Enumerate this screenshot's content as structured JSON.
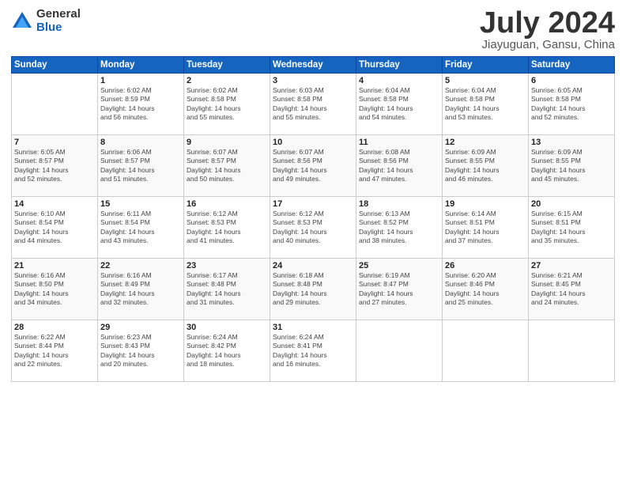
{
  "logo": {
    "general": "General",
    "blue": "Blue"
  },
  "title": "July 2024",
  "subtitle": "Jiayuguan, Gansu, China",
  "days_header": [
    "Sunday",
    "Monday",
    "Tuesday",
    "Wednesday",
    "Thursday",
    "Friday",
    "Saturday"
  ],
  "weeks": [
    [
      {
        "num": "",
        "info": ""
      },
      {
        "num": "1",
        "info": "Sunrise: 6:02 AM\nSunset: 8:59 PM\nDaylight: 14 hours\nand 56 minutes."
      },
      {
        "num": "2",
        "info": "Sunrise: 6:02 AM\nSunset: 8:58 PM\nDaylight: 14 hours\nand 55 minutes."
      },
      {
        "num": "3",
        "info": "Sunrise: 6:03 AM\nSunset: 8:58 PM\nDaylight: 14 hours\nand 55 minutes."
      },
      {
        "num": "4",
        "info": "Sunrise: 6:04 AM\nSunset: 8:58 PM\nDaylight: 14 hours\nand 54 minutes."
      },
      {
        "num": "5",
        "info": "Sunrise: 6:04 AM\nSunset: 8:58 PM\nDaylight: 14 hours\nand 53 minutes."
      },
      {
        "num": "6",
        "info": "Sunrise: 6:05 AM\nSunset: 8:58 PM\nDaylight: 14 hours\nand 52 minutes."
      }
    ],
    [
      {
        "num": "7",
        "info": "Sunrise: 6:05 AM\nSunset: 8:57 PM\nDaylight: 14 hours\nand 52 minutes."
      },
      {
        "num": "8",
        "info": "Sunrise: 6:06 AM\nSunset: 8:57 PM\nDaylight: 14 hours\nand 51 minutes."
      },
      {
        "num": "9",
        "info": "Sunrise: 6:07 AM\nSunset: 8:57 PM\nDaylight: 14 hours\nand 50 minutes."
      },
      {
        "num": "10",
        "info": "Sunrise: 6:07 AM\nSunset: 8:56 PM\nDaylight: 14 hours\nand 49 minutes."
      },
      {
        "num": "11",
        "info": "Sunrise: 6:08 AM\nSunset: 8:56 PM\nDaylight: 14 hours\nand 47 minutes."
      },
      {
        "num": "12",
        "info": "Sunrise: 6:09 AM\nSunset: 8:55 PM\nDaylight: 14 hours\nand 46 minutes."
      },
      {
        "num": "13",
        "info": "Sunrise: 6:09 AM\nSunset: 8:55 PM\nDaylight: 14 hours\nand 45 minutes."
      }
    ],
    [
      {
        "num": "14",
        "info": "Sunrise: 6:10 AM\nSunset: 8:54 PM\nDaylight: 14 hours\nand 44 minutes."
      },
      {
        "num": "15",
        "info": "Sunrise: 6:11 AM\nSunset: 8:54 PM\nDaylight: 14 hours\nand 43 minutes."
      },
      {
        "num": "16",
        "info": "Sunrise: 6:12 AM\nSunset: 8:53 PM\nDaylight: 14 hours\nand 41 minutes."
      },
      {
        "num": "17",
        "info": "Sunrise: 6:12 AM\nSunset: 8:53 PM\nDaylight: 14 hours\nand 40 minutes."
      },
      {
        "num": "18",
        "info": "Sunrise: 6:13 AM\nSunset: 8:52 PM\nDaylight: 14 hours\nand 38 minutes."
      },
      {
        "num": "19",
        "info": "Sunrise: 6:14 AM\nSunset: 8:51 PM\nDaylight: 14 hours\nand 37 minutes."
      },
      {
        "num": "20",
        "info": "Sunrise: 6:15 AM\nSunset: 8:51 PM\nDaylight: 14 hours\nand 35 minutes."
      }
    ],
    [
      {
        "num": "21",
        "info": "Sunrise: 6:16 AM\nSunset: 8:50 PM\nDaylight: 14 hours\nand 34 minutes."
      },
      {
        "num": "22",
        "info": "Sunrise: 6:16 AM\nSunset: 8:49 PM\nDaylight: 14 hours\nand 32 minutes."
      },
      {
        "num": "23",
        "info": "Sunrise: 6:17 AM\nSunset: 8:48 PM\nDaylight: 14 hours\nand 31 minutes."
      },
      {
        "num": "24",
        "info": "Sunrise: 6:18 AM\nSunset: 8:48 PM\nDaylight: 14 hours\nand 29 minutes."
      },
      {
        "num": "25",
        "info": "Sunrise: 6:19 AM\nSunset: 8:47 PM\nDaylight: 14 hours\nand 27 minutes."
      },
      {
        "num": "26",
        "info": "Sunrise: 6:20 AM\nSunset: 8:46 PM\nDaylight: 14 hours\nand 25 minutes."
      },
      {
        "num": "27",
        "info": "Sunrise: 6:21 AM\nSunset: 8:45 PM\nDaylight: 14 hours\nand 24 minutes."
      }
    ],
    [
      {
        "num": "28",
        "info": "Sunrise: 6:22 AM\nSunset: 8:44 PM\nDaylight: 14 hours\nand 22 minutes."
      },
      {
        "num": "29",
        "info": "Sunrise: 6:23 AM\nSunset: 8:43 PM\nDaylight: 14 hours\nand 20 minutes."
      },
      {
        "num": "30",
        "info": "Sunrise: 6:24 AM\nSunset: 8:42 PM\nDaylight: 14 hours\nand 18 minutes."
      },
      {
        "num": "31",
        "info": "Sunrise: 6:24 AM\nSunset: 8:41 PM\nDaylight: 14 hours\nand 16 minutes."
      },
      {
        "num": "",
        "info": ""
      },
      {
        "num": "",
        "info": ""
      },
      {
        "num": "",
        "info": ""
      }
    ]
  ]
}
